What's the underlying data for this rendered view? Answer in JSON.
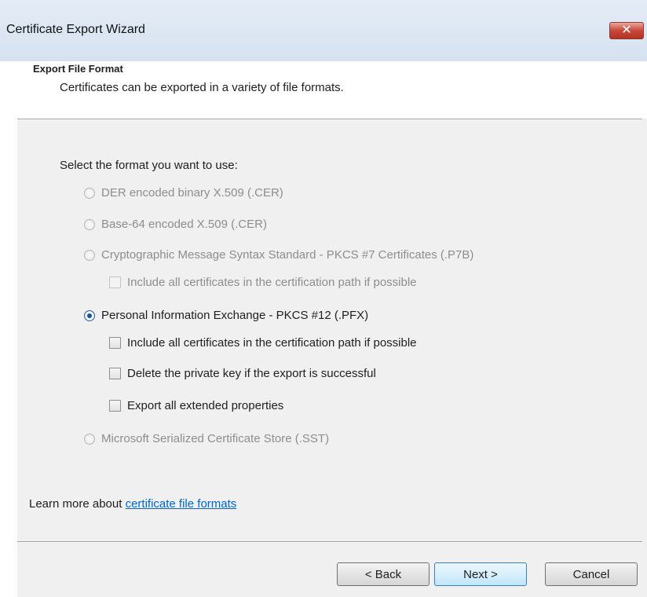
{
  "window": {
    "title": "Certificate Export Wizard"
  },
  "header": {
    "section_title": "Export File Format",
    "description": "Certificates can be exported in a variety of file formats."
  },
  "prompt": "Select the format you want to use:",
  "options": {
    "der": "DER encoded binary X.509 (.CER)",
    "base64": "Base-64 encoded X.509 (.CER)",
    "pkcs7": "Cryptographic Message Syntax Standard - PKCS #7 Certificates (.P7B)",
    "pkcs7_include": "Include all certificates in the certification path if possible",
    "pfx": "Personal Information Exchange - PKCS #12 (.PFX)",
    "pfx_include": "Include all certificates in the certification path if possible",
    "pfx_delete_key": "Delete the private key if the export is successful",
    "pfx_export_props": "Export all extended properties",
    "sst": "Microsoft Serialized Certificate Store (.SST)"
  },
  "learn_more": {
    "prefix": "Learn more about ",
    "link": "certificate file formats"
  },
  "buttons": {
    "back": "< Back",
    "next": "Next >",
    "cancel": "Cancel"
  },
  "colors": {
    "link": "#0066cc",
    "disabled_text": "#8d8d8d",
    "background": "#f0f0f0"
  },
  "selected_format": "pfx"
}
